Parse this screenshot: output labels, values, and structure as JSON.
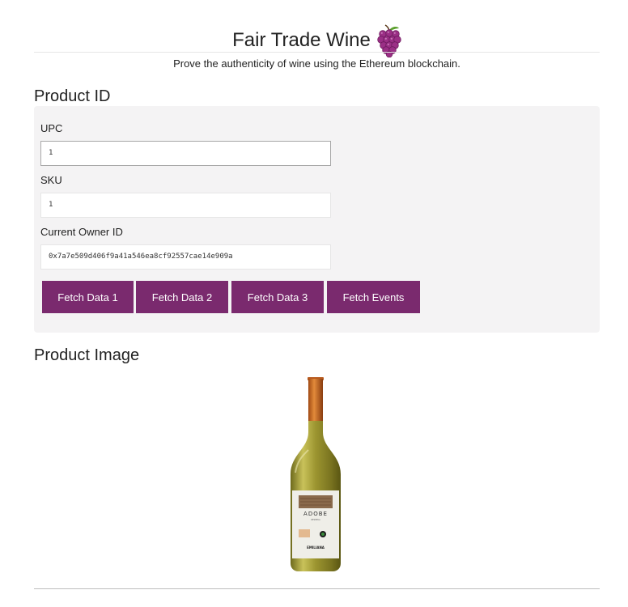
{
  "header": {
    "title": "Fair Trade Wine",
    "subtitle": "Prove the authenticity of wine using the Ethereum blockchain."
  },
  "product_id": {
    "heading": "Product ID",
    "upc": {
      "label": "UPC",
      "value": "1"
    },
    "sku": {
      "label": "SKU",
      "value": "1"
    },
    "owner": {
      "label": "Current Owner ID",
      "value": "0x7a7e509d406f9a41a546ea8cf92557cae14e909a"
    },
    "buttons": {
      "fetch1": "Fetch Data 1",
      "fetch2": "Fetch Data 2",
      "fetch3": "Fetch Data 3",
      "events": "Fetch Events"
    }
  },
  "product_image": {
    "heading": "Product Image",
    "label_brand": "ADOBE",
    "label_producer": "EMILIANA"
  },
  "colors": {
    "accent": "#7a2a6e",
    "panel_bg": "#f4f3f4",
    "grape": "#9b2f86"
  },
  "icons": {
    "title_icon": "grapes-icon"
  }
}
